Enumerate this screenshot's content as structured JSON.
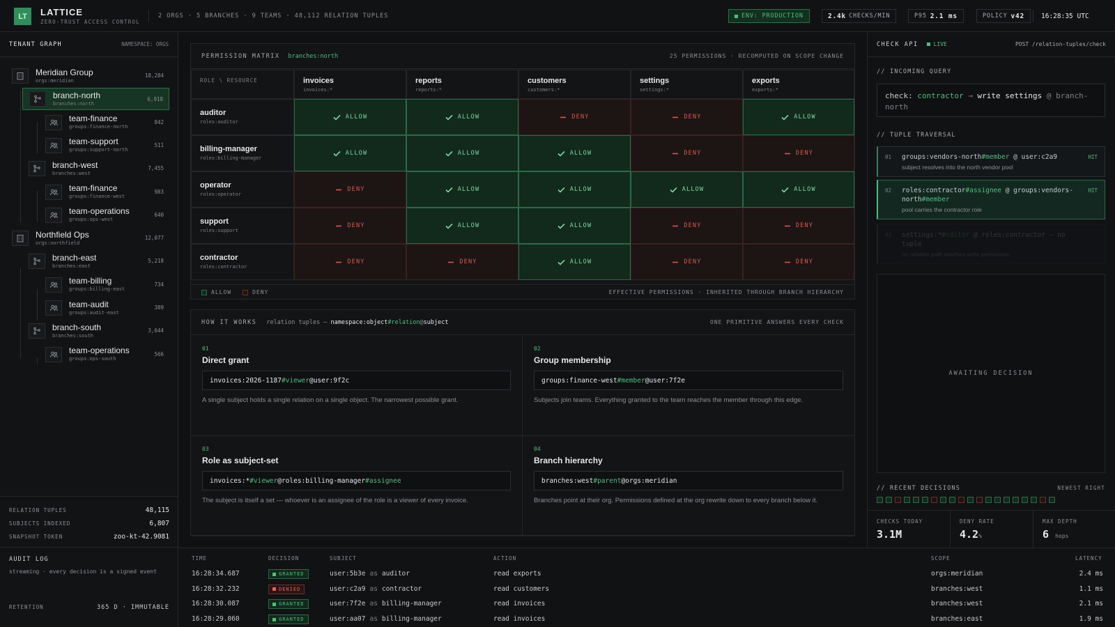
{
  "header": {
    "logo": "LT",
    "title": "LATTICE",
    "subtitle": "ZERO-TRUST ACCESS CONTROL",
    "stats": "2 ORGS · 5 BRANCHES · 9 TEAMS · 48,112 RELATION TUPLES",
    "env": "ENV: PRODUCTION",
    "checks_value": "2.4k",
    "checks_label": "CHECKS/MIN",
    "p95_label": "P95",
    "p95_value": "2.1 ms",
    "policy_label": "POLICY",
    "policy_value": "v42",
    "clock": "16:28:35 UTC"
  },
  "sidebar": {
    "title": "TENANT GRAPH",
    "namespace": "NAMESPACE: ORGS",
    "nodes": [
      {
        "name": "Meridian Group",
        "ns": "orgs:meridian",
        "count": "18,284",
        "level": 0,
        "icon": "building-icon"
      },
      {
        "name": "branch-north",
        "ns": "branches:north",
        "count": "6,918",
        "level": 1,
        "icon": "branch-icon",
        "selected": true
      },
      {
        "name": "team-finance",
        "ns": "groups:finance-north",
        "count": "842",
        "level": 2,
        "icon": "team-icon"
      },
      {
        "name": "team-support",
        "ns": "groups:support-north",
        "count": "511",
        "level": 2,
        "icon": "team-icon"
      },
      {
        "name": "branch-west",
        "ns": "branches:west",
        "count": "7,455",
        "level": 1,
        "icon": "branch-icon"
      },
      {
        "name": "team-finance",
        "ns": "groups:finance-west",
        "count": "983",
        "level": 2,
        "icon": "team-icon"
      },
      {
        "name": "team-operations",
        "ns": "groups:ops-west",
        "count": "640",
        "level": 2,
        "icon": "team-icon"
      },
      {
        "name": "Northfield Ops",
        "ns": "orgs:northfield",
        "count": "12,077",
        "level": 0,
        "icon": "building-icon"
      },
      {
        "name": "branch-east",
        "ns": "branches:east",
        "count": "5,218",
        "level": 1,
        "icon": "branch-icon"
      },
      {
        "name": "team-billing",
        "ns": "groups:billing-east",
        "count": "734",
        "level": 2,
        "icon": "team-icon"
      },
      {
        "name": "team-audit",
        "ns": "groups:audit-east",
        "count": "389",
        "level": 2,
        "icon": "team-icon"
      },
      {
        "name": "branch-south",
        "ns": "branches:south",
        "count": "3,644",
        "level": 1,
        "icon": "branch-icon"
      },
      {
        "name": "team-operations",
        "ns": "groups:ops-south",
        "count": "566",
        "level": 2,
        "icon": "team-icon"
      }
    ],
    "stats": [
      {
        "label": "RELATION TUPLES",
        "value": "48,115"
      },
      {
        "label": "SUBJECTS INDEXED",
        "value": "6,807"
      },
      {
        "label": "SNAPSHOT TOKEN",
        "value": "zoo-kt-42.9081"
      }
    ],
    "audit": {
      "title": "AUDIT LOG",
      "desc": "streaming · every decision is a signed event",
      "retention_label": "RETENTION",
      "retention_value": "365 D · IMMUTABLE"
    }
  },
  "matrix": {
    "title": "PERMISSION MATRIX",
    "scope": "branches:north",
    "right": "25 PERMISSIONS · RECOMPUTED ON SCOPE CHANGE",
    "corner": "ROLE \\ RESOURCE",
    "columns": [
      {
        "name": "invoices",
        "ns": "invoices:*"
      },
      {
        "name": "reports",
        "ns": "reports:*"
      },
      {
        "name": "customers",
        "ns": "customers:*"
      },
      {
        "name": "settings",
        "ns": "settings:*"
      },
      {
        "name": "exports",
        "ns": "exports:*"
      }
    ],
    "rows": [
      {
        "name": "auditor",
        "ns": "roles:auditor",
        "cells": [
          "ALLOW",
          "ALLOW",
          "DENY",
          "DENY",
          "ALLOW"
        ]
      },
      {
        "name": "billing-manager",
        "ns": "roles:billing-manager",
        "cells": [
          "ALLOW",
          "ALLOW",
          "ALLOW",
          "DENY",
          "DENY"
        ]
      },
      {
        "name": "operator",
        "ns": "roles:operator",
        "cells": [
          "DENY",
          "ALLOW",
          "ALLOW",
          "ALLOW",
          "ALLOW"
        ]
      },
      {
        "name": "support",
        "ns": "roles:support",
        "cells": [
          "DENY",
          "ALLOW",
          "ALLOW",
          "DENY",
          "DENY"
        ]
      },
      {
        "name": "contractor",
        "ns": "roles:contractor",
        "cells": [
          "DENY",
          "DENY",
          "ALLOW",
          "DENY",
          "DENY"
        ]
      }
    ],
    "legend_allow": "ALLOW",
    "legend_deny": "DENY",
    "footer": "EFFECTIVE PERMISSIONS · INHERITED THROUGH BRANCH HIERARCHY"
  },
  "how": {
    "title": "HOW IT WORKS",
    "formula_prefix": "relation tuples —",
    "formula_ns": "namespace:object",
    "formula_rel": "#relation",
    "formula_at": "@",
    "formula_subj": "subject",
    "right": "ONE PRIMITIVE ANSWERS EVERY CHECK",
    "cards": [
      {
        "num": "01",
        "title": "Direct grant",
        "code_a": "invoices:2026-1187",
        "code_b": "#viewer",
        "code_c": "@user:9f2c",
        "code_d": "",
        "desc": "A single subject holds a single relation on a single object. The narrowest possible grant."
      },
      {
        "num": "02",
        "title": "Group membership",
        "code_a": "groups:finance-west",
        "code_b": "#member",
        "code_c": "@user:7f2e",
        "code_d": "",
        "desc": "Subjects join teams. Everything granted to the team reaches the member through this edge."
      },
      {
        "num": "03",
        "title": "Role as subject-set",
        "code_a": "invoices:*",
        "code_b": "#viewer",
        "code_c": "@roles:billing-manager",
        "code_d": "#assignee",
        "desc": "The subject is itself a set — whoever is an assignee of the role is a viewer of every invoice."
      },
      {
        "num": "04",
        "title": "Branch hierarchy",
        "code_a": "branches:west",
        "code_b": "#parent",
        "code_c": "@orgs:meridian",
        "code_d": "",
        "desc": "Branches point at their org. Permissions defined at the org rewrite down to every branch below it."
      }
    ]
  },
  "check": {
    "title": "CHECK API",
    "live": "LIVE",
    "endpoint": "POST /relation-tuples/check",
    "incoming_label": "// INCOMING QUERY",
    "query_prefix": "check:",
    "query_subject": "contractor",
    "query_arrow": "→",
    "query_action": "write settings",
    "query_at": "@ branch-north",
    "traversal_label": "// TUPLE TRAVERSAL",
    "steps": [
      {
        "n": "01",
        "obj": "groups:vendors-north",
        "rel": "#member",
        "subj": " @ user:c2a9",
        "rel2": "",
        "comment": "subject resolves into the north vendor pool",
        "hit": "HIT"
      },
      {
        "n": "02",
        "obj": "roles:contractor",
        "rel": "#assignee",
        "subj": " @ groups:vendors-north",
        "rel2": "#member",
        "comment": "pool carries the contractor role",
        "hit": "HIT"
      },
      {
        "n": "03",
        "obj": "settings:*",
        "rel": "#editor",
        "subj": " @ roles:contractor — no tuple",
        "rel2": "",
        "comment": "no relation path reaches write permission",
        "hit": ""
      }
    ],
    "awaiting": "AWAITING DECISION",
    "recent_label": "// RECENT DECISIONS",
    "recent_right": "NEWEST RIGHT",
    "recent": [
      "A",
      "A",
      "D",
      "A",
      "A",
      "A",
      "D",
      "A",
      "A",
      "D",
      "A",
      "D",
      "A",
      "A",
      "A",
      "A",
      "A",
      "A",
      "D",
      "A"
    ],
    "kpis": [
      {
        "label": "CHECKS TODAY",
        "value": "3.1M",
        "unit": ""
      },
      {
        "label": "DENY RATE",
        "value": "4.2",
        "unit": "%"
      },
      {
        "label": "MAX DEPTH",
        "value": "6",
        "unit": "hops"
      }
    ]
  },
  "log": {
    "headers": {
      "time": "TIME",
      "decision": "DECISION",
      "subject": "SUBJECT",
      "action": "ACTION",
      "scope": "SCOPE",
      "latency": "LATENCY"
    },
    "as_word": "as",
    "rows": [
      {
        "time": "16:28:34.687",
        "decision": "GRANTED",
        "user": "user:5b3e",
        "role": "auditor",
        "action": "read exports",
        "scope": "orgs:meridian",
        "latency": "2.4 ms"
      },
      {
        "time": "16:28:32.232",
        "decision": "DENIED",
        "user": "user:c2a9",
        "role": "contractor",
        "action": "read customers",
        "scope": "branches:west",
        "latency": "1.1 ms"
      },
      {
        "time": "16:28:30.087",
        "decision": "GRANTED",
        "user": "user:7f2e",
        "role": "billing-manager",
        "action": "read invoices",
        "scope": "branches:west",
        "latency": "2.1 ms"
      },
      {
        "time": "16:28:29.060",
        "decision": "GRANTED",
        "user": "user:aa07",
        "role": "billing-manager",
        "action": "read invoices",
        "scope": "branches:east",
        "latency": "1.9 ms"
      }
    ]
  }
}
